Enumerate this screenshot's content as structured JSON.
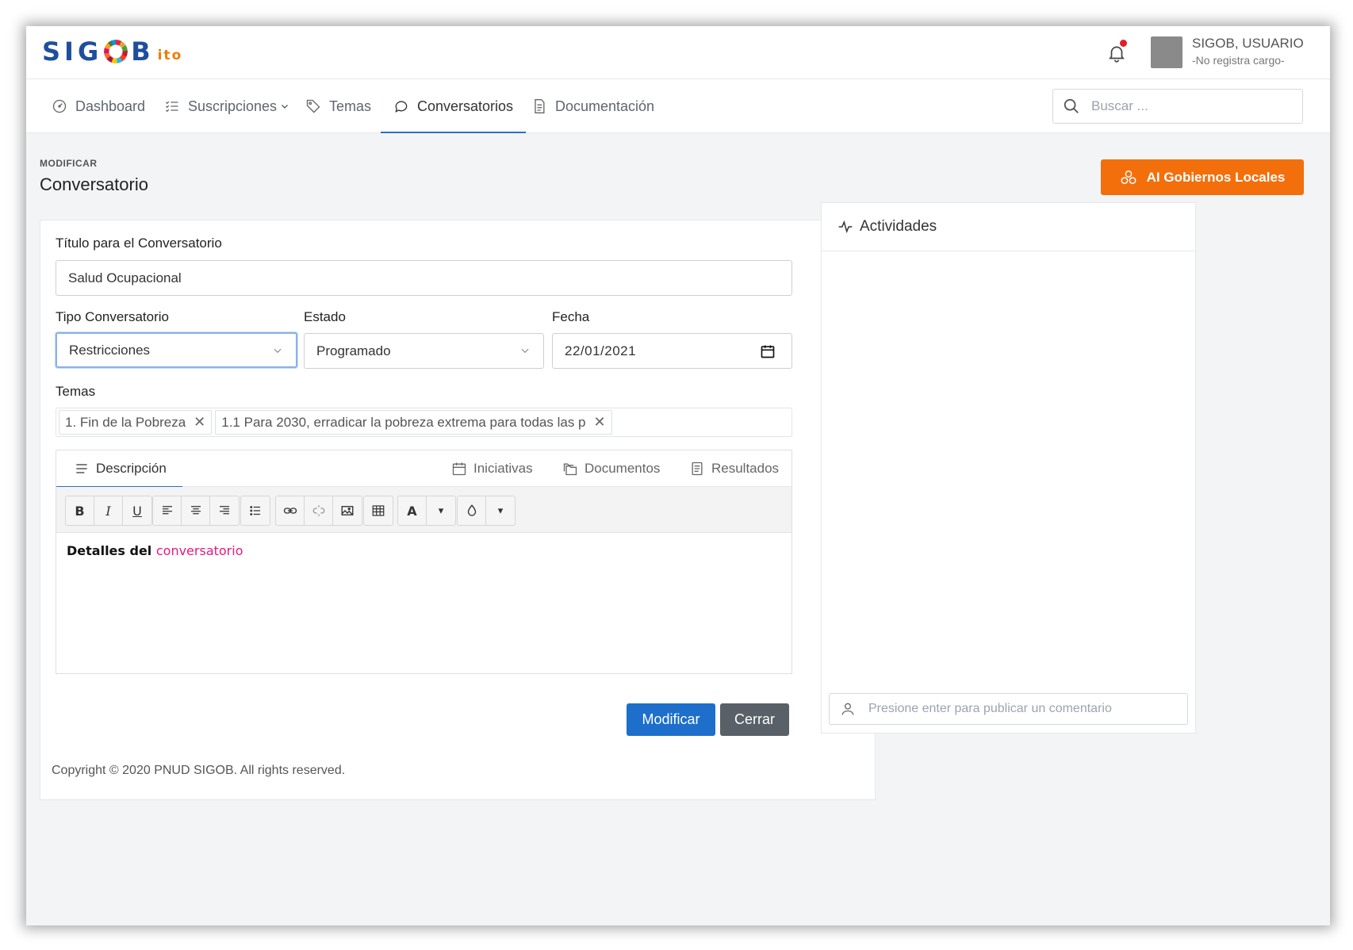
{
  "header": {
    "logo_main_left": "SIG",
    "logo_main_right": "B",
    "logo_suffix": "ito",
    "user_name": "SIGOB, USUARIO",
    "user_role": "-No registra cargo-"
  },
  "nav": {
    "items": [
      {
        "label": "Dashboard",
        "icon": "gauge-icon"
      },
      {
        "label": "Suscripciones",
        "icon": "checklist-icon",
        "has_dropdown": true
      },
      {
        "label": "Temas",
        "icon": "tag-icon"
      },
      {
        "label": "Conversatorios",
        "icon": "chat-icon",
        "active": true
      },
      {
        "label": "Documentación",
        "icon": "document-icon"
      }
    ],
    "search_placeholder": "Buscar ..."
  },
  "page": {
    "eyebrow": "MODIFICAR",
    "title": "Conversatorio",
    "action_button": "AI Gobiernos Locales",
    "action_color": "#f36f0c"
  },
  "form": {
    "title_label": "Título para el Conversatorio",
    "title_value": "Salud Ocupacional",
    "tipo_label": "Tipo Conversatorio",
    "tipo_value": "Restricciones",
    "estado_label": "Estado",
    "estado_value": "Programado",
    "fecha_label": "Fecha",
    "fecha_value": "22/01/2021",
    "temas_label": "Temas",
    "temas": [
      "1. Fin de la Pobreza",
      "1.1 Para 2030, erradicar la pobreza extrema para todas las p"
    ]
  },
  "tabs": [
    {
      "label": "Descripción",
      "icon": "lines-icon",
      "active": true
    },
    {
      "label": "Iniciativas",
      "icon": "calendar-icon"
    },
    {
      "label": "Documentos",
      "icon": "folders-icon"
    },
    {
      "label": "Resultados",
      "icon": "list-doc-icon"
    }
  ],
  "toolbar": {
    "bold": "B",
    "italic": "I",
    "underline": "U",
    "font_color": "A",
    "caret": "▾"
  },
  "editor": {
    "text_bold": "Detalles del",
    "text_accent": "conversatorio",
    "accent_color": "#e6187d"
  },
  "buttons": {
    "save": "Modificar",
    "close": "Cerrar",
    "save_color": "#1d6fcb",
    "close_color": "#5a6068"
  },
  "activities": {
    "title": "Actividades",
    "comment_placeholder": "Presione enter para publicar un comentario"
  },
  "footer": {
    "copyright": "Copyright © 2020 PNUD SIGOB. All rights reserved."
  }
}
